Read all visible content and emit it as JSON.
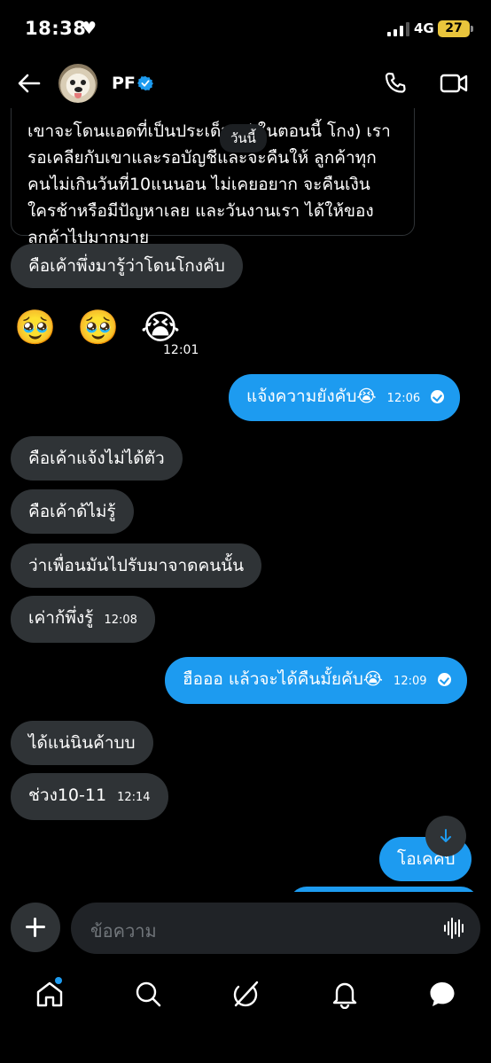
{
  "status_bar": {
    "time": "18:38",
    "network": "4G",
    "battery": "27"
  },
  "header": {
    "contact_name": "PF"
  },
  "day_divider": "วันนี้",
  "messages": [
    {
      "id": "m1",
      "dir": "in",
      "text": "เขาจะโดนแอดที่เป็นประเด็นอยู่ ในตอนนี้ โกง) เรารอเคลียกับเขาและรอบัญชีและจะคืนให้ ลูกค้าทุกคนไม่เกินวันที่10แนนอน ไม่เคยอยาก จะคืนเงินใครช้าหรือมีปัญหาเลย และวันงานเรา ได้ให้ของลูกค้าไปมากมาย"
    },
    {
      "id": "m2",
      "dir": "in",
      "text": "คือเค้าพึ่งมารู้ว่าโดนโกงคับ"
    },
    {
      "id": "m3",
      "dir": "in",
      "text": "🥹 🥹 😭",
      "time": "12:01"
    },
    {
      "id": "m4",
      "dir": "out",
      "text": "แจ้งความยังคับ😭",
      "time": "12:06"
    },
    {
      "id": "m5",
      "dir": "in",
      "text": "คือเค้าแจ้งไม่ได้ตัว"
    },
    {
      "id": "m6",
      "dir": "in",
      "text": "คือเค้าด้ไม่รู้"
    },
    {
      "id": "m7",
      "dir": "in",
      "text": "ว่าเพื่อนมันไปรับมาจาดคนนั้น"
    },
    {
      "id": "m8",
      "dir": "in",
      "text": "เค่าก้พึ่งรู้",
      "time": "12:08"
    },
    {
      "id": "m9",
      "dir": "out",
      "text": "ฮือออ แล้วจะได้คืนมั้ยคับ😭",
      "time": "12:09"
    },
    {
      "id": "m10",
      "dir": "in",
      "text": "ได้แน่นินค้าบบ"
    },
    {
      "id": "m11",
      "dir": "in",
      "text": "ช่วง10-11",
      "time": "12:14"
    },
    {
      "id": "m12",
      "dir": "out",
      "text": "โอเคคับ"
    }
  ],
  "composer": {
    "placeholder": "ข้อความ"
  },
  "icons": {
    "back": "arrow-left-icon",
    "verified": "verified-badge-icon",
    "call": "phone-icon",
    "video": "video-camera-icon",
    "scroll": "arrow-down-icon",
    "add": "plus-icon",
    "voice": "voice-wave-icon",
    "home": "home-icon",
    "search": "search-icon",
    "grok": "grok-icon",
    "notifications": "bell-icon",
    "messages": "messages-icon"
  },
  "colors": {
    "accent": "#1d9bf0",
    "incoming_bubble": "#2f3336",
    "background": "#000000",
    "battery": "#e9c53c"
  }
}
